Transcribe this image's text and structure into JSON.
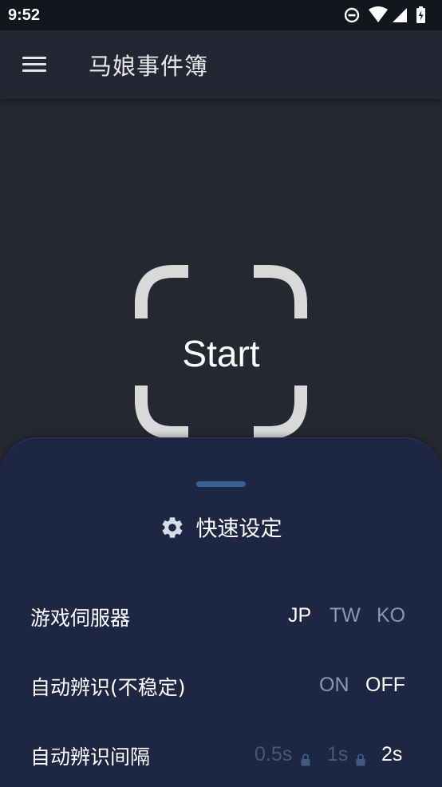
{
  "status_bar": {
    "time": "9:52",
    "icons": [
      "do-not-disturb-icon",
      "wifi-icon",
      "signal-icon",
      "battery-charging-icon"
    ]
  },
  "app_bar": {
    "menu_icon": "menu-icon",
    "title": "马娘事件簿"
  },
  "start": {
    "label": "Start"
  },
  "quick_settings": {
    "icon": "gear-icon",
    "title": "快速设定",
    "server": {
      "label": "游戏伺服器",
      "options": [
        "JP",
        "TW",
        "KO"
      ],
      "selected": "JP"
    },
    "auto_detect": {
      "label": "自动辨识(不稳定)",
      "options": [
        "ON",
        "OFF"
      ],
      "selected": "OFF"
    },
    "interval": {
      "label": "自动辨识间隔",
      "options": [
        "0.5s",
        "1s",
        "2s"
      ],
      "locked": [
        "0.5s",
        "1s"
      ],
      "selected": "2s"
    }
  },
  "colors": {
    "background": "#252833",
    "app_bar": "#242733",
    "status_bar": "#14161d",
    "sheet": "#1d2744",
    "handle": "#3a5f92",
    "bracket": "#d9d9d9",
    "option_active": "#ffffff",
    "option_inactive": "#8b98ad",
    "option_locked": "#415a7f"
  }
}
